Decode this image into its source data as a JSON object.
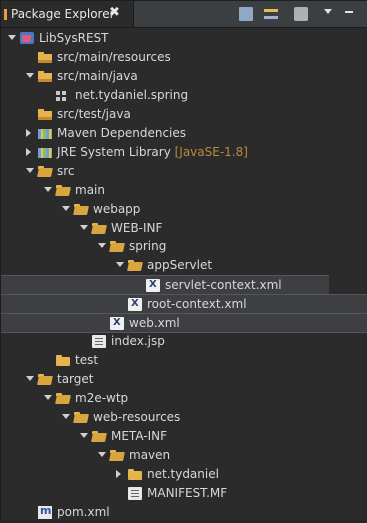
{
  "view": {
    "title": "Package Explorer",
    "close_symbol": "✖",
    "toolbar": [
      {
        "name": "collapse-all-icon",
        "color": "#9fb3d0"
      },
      {
        "name": "link-with-editor-icon",
        "color": "#e0c050"
      },
      {
        "name": "focus-icon",
        "color": "#b0b0b0"
      },
      {
        "name": "view-menu-icon",
        "color": "#e0e0e0"
      },
      {
        "name": "minimize-icon",
        "color": "#e0e0e0"
      }
    ]
  },
  "tree": [
    {
      "label": "LibSysREST",
      "icon": "project-icon",
      "twisty": "open",
      "level": 0
    },
    {
      "label": "src/main/resources",
      "icon": "source-folder-icon",
      "twisty": "none",
      "level": 1
    },
    {
      "label": "src/main/java",
      "icon": "source-folder-icon",
      "twisty": "open",
      "level": 1
    },
    {
      "label": "net.tydaniel.spring",
      "icon": "package-icon",
      "twisty": "none",
      "level": 2
    },
    {
      "label": "src/test/java",
      "icon": "source-folder-icon",
      "twisty": "none",
      "level": 1
    },
    {
      "label": "Maven Dependencies",
      "icon": "library-icon",
      "twisty": "closed",
      "level": 1
    },
    {
      "label": "JRE System Library",
      "decoration": "[JavaSE-1.8]",
      "icon": "library-icon",
      "twisty": "closed",
      "level": 1
    },
    {
      "label": "src",
      "icon": "folder-open-icon",
      "twisty": "open",
      "level": 1
    },
    {
      "label": "main",
      "icon": "folder-open-icon",
      "twisty": "open",
      "level": 2
    },
    {
      "label": "webapp",
      "icon": "folder-open-icon",
      "twisty": "open",
      "level": 3
    },
    {
      "label": "WEB-INF",
      "icon": "folder-open-icon",
      "twisty": "open",
      "level": 4
    },
    {
      "label": "spring",
      "icon": "folder-open-icon",
      "twisty": "open",
      "level": 5
    },
    {
      "label": "appServlet",
      "icon": "folder-open-icon",
      "twisty": "open",
      "level": 6
    },
    {
      "label": "servlet-context.xml",
      "icon": "xml-file-icon",
      "twisty": "none",
      "level": 7,
      "selected": true
    },
    {
      "label": "root-context.xml",
      "icon": "xml-file-icon",
      "twisty": "none",
      "level": 6,
      "selected": true
    },
    {
      "label": "web.xml",
      "icon": "xml-file-icon",
      "twisty": "none",
      "level": 5,
      "selected": true
    },
    {
      "label": "index.jsp",
      "icon": "file-icon",
      "twisty": "none",
      "level": 4
    },
    {
      "label": "test",
      "icon": "folder-icon",
      "twisty": "none",
      "level": 2
    },
    {
      "label": "target",
      "icon": "folder-open-icon",
      "twisty": "open",
      "level": 1
    },
    {
      "label": "m2e-wtp",
      "icon": "folder-open-icon",
      "twisty": "open",
      "level": 2
    },
    {
      "label": "web-resources",
      "icon": "folder-open-icon",
      "twisty": "open",
      "level": 3
    },
    {
      "label": "META-INF",
      "icon": "folder-open-icon",
      "twisty": "open",
      "level": 4
    },
    {
      "label": "maven",
      "icon": "folder-open-icon",
      "twisty": "open",
      "level": 5
    },
    {
      "label": "net.tydaniel",
      "icon": "folder-icon",
      "twisty": "closed",
      "level": 6
    },
    {
      "label": "MANIFEST.MF",
      "icon": "file-icon",
      "twisty": "none",
      "level": 6
    },
    {
      "label": "pom.xml",
      "icon": "pom-file-icon",
      "twisty": "none",
      "level": 1
    }
  ]
}
